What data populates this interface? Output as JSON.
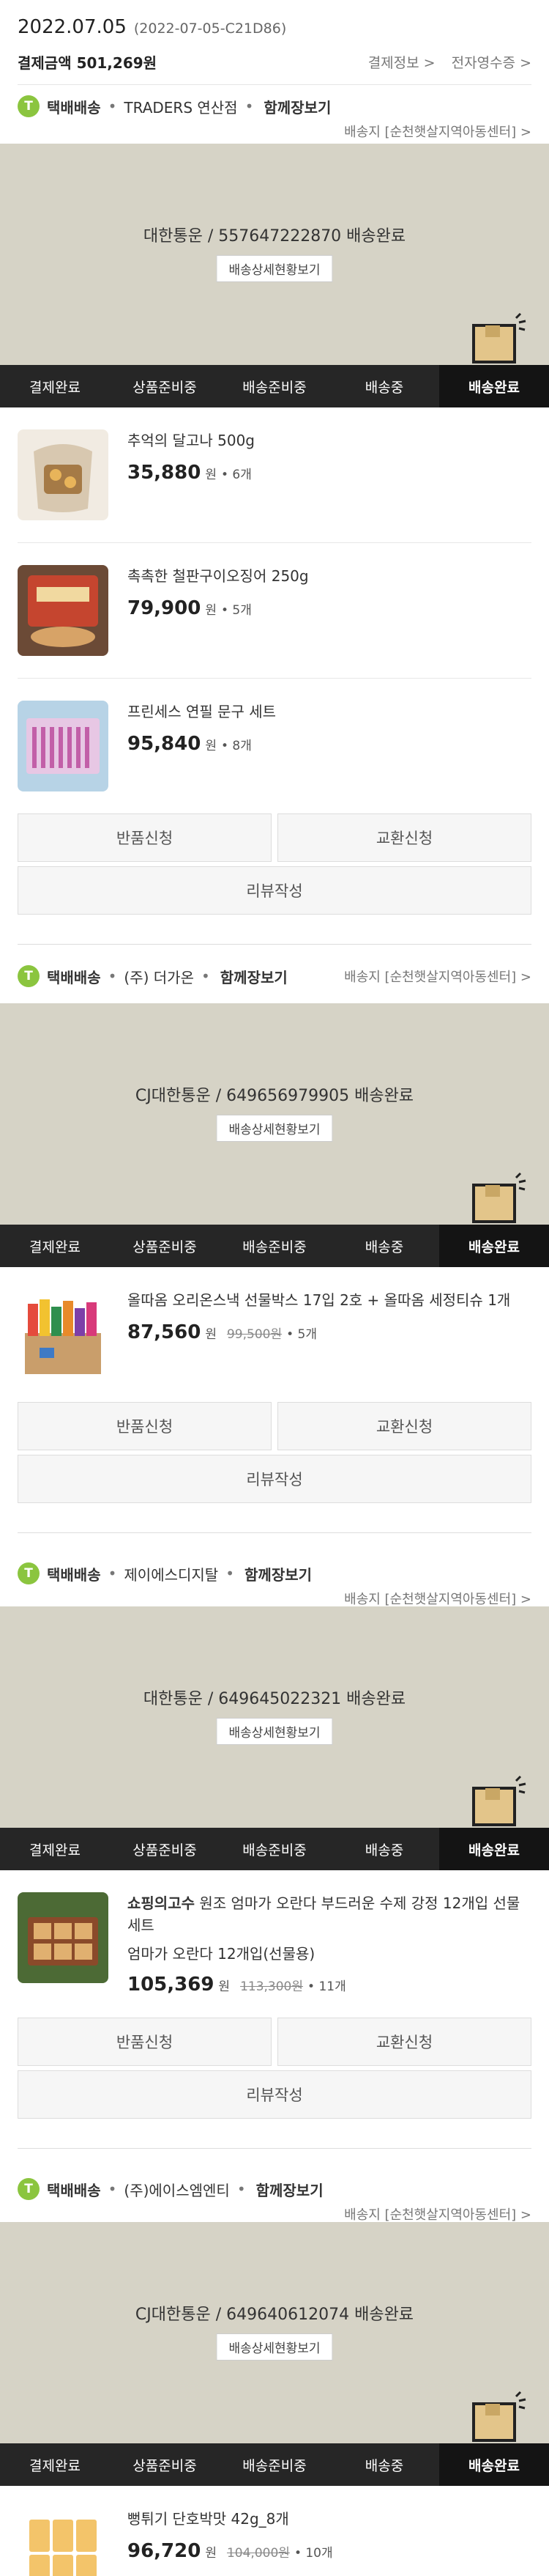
{
  "header": {
    "date": "2022.07.05",
    "code": "(2022-07-05-C21D86)",
    "payment": "결제금액 501,269원",
    "link_payinfo": "결제정보 >",
    "link_receipt": "전자영수증 >"
  },
  "steps": [
    "결제완료",
    "상품준비중",
    "배송준비중",
    "배송중",
    "배송완료"
  ],
  "common": {
    "type": "택배배송",
    "more": "함께장보기",
    "tracking_btn": "배송상세현황보기",
    "return_btn": "반품신청",
    "exchange_btn": "교환신청",
    "review_btn": "리뷰작성",
    "won": "원",
    "dest": "배송지 [순천햇살지역아동센터] >"
  },
  "shipments": [
    {
      "store": "TRADERS 연산점",
      "carrier": "대한통운 / 557647222870 배송완료",
      "items": [
        {
          "name": "추억의 달고나 500g",
          "price": "35,880",
          "qty": "• 6개"
        },
        {
          "name": "촉촉한 철판구이오징어 250g",
          "price": "79,900",
          "qty": "• 5개"
        },
        {
          "name": "프린세스 연필 문구 세트",
          "price": "95,840",
          "qty": "• 8개"
        }
      ]
    },
    {
      "store": "(주) 더가온",
      "carrier": "CJ대한통운 / 649656979905 배송완료",
      "items": [
        {
          "name": "올따옴 오리온스낵 선물박스 17입 2호 + 올따옴 세정티슈 1개",
          "price": "87,560",
          "orig": "99,500원",
          "qty": "• 5개"
        }
      ]
    },
    {
      "store": "제이에스디지탈",
      "carrier": "대한통운 / 649645022321 배송완료",
      "items": [
        {
          "brand": "쇼핑의고수",
          "name": "원조 엄마가 오란다 부드러운 수제 강정 12개입 선물세트",
          "option": "엄마가 오란다 12개입(선물용)",
          "price": "105,369",
          "orig": "113,300원",
          "qty": "• 11개"
        }
      ]
    },
    {
      "store": "(주)에이스엠엔티",
      "carrier": "CJ대한통운 / 649640612074 배송완료",
      "items": [
        {
          "name": "뻥튀기 단호박맛 42g_8개",
          "price": "96,720",
          "orig": "104,000원",
          "qty": "• 10개"
        }
      ]
    }
  ],
  "colors": {
    "badge": "#8bc53f",
    "status_bg": "#d6d3c6",
    "steps_bg": "#262626"
  }
}
